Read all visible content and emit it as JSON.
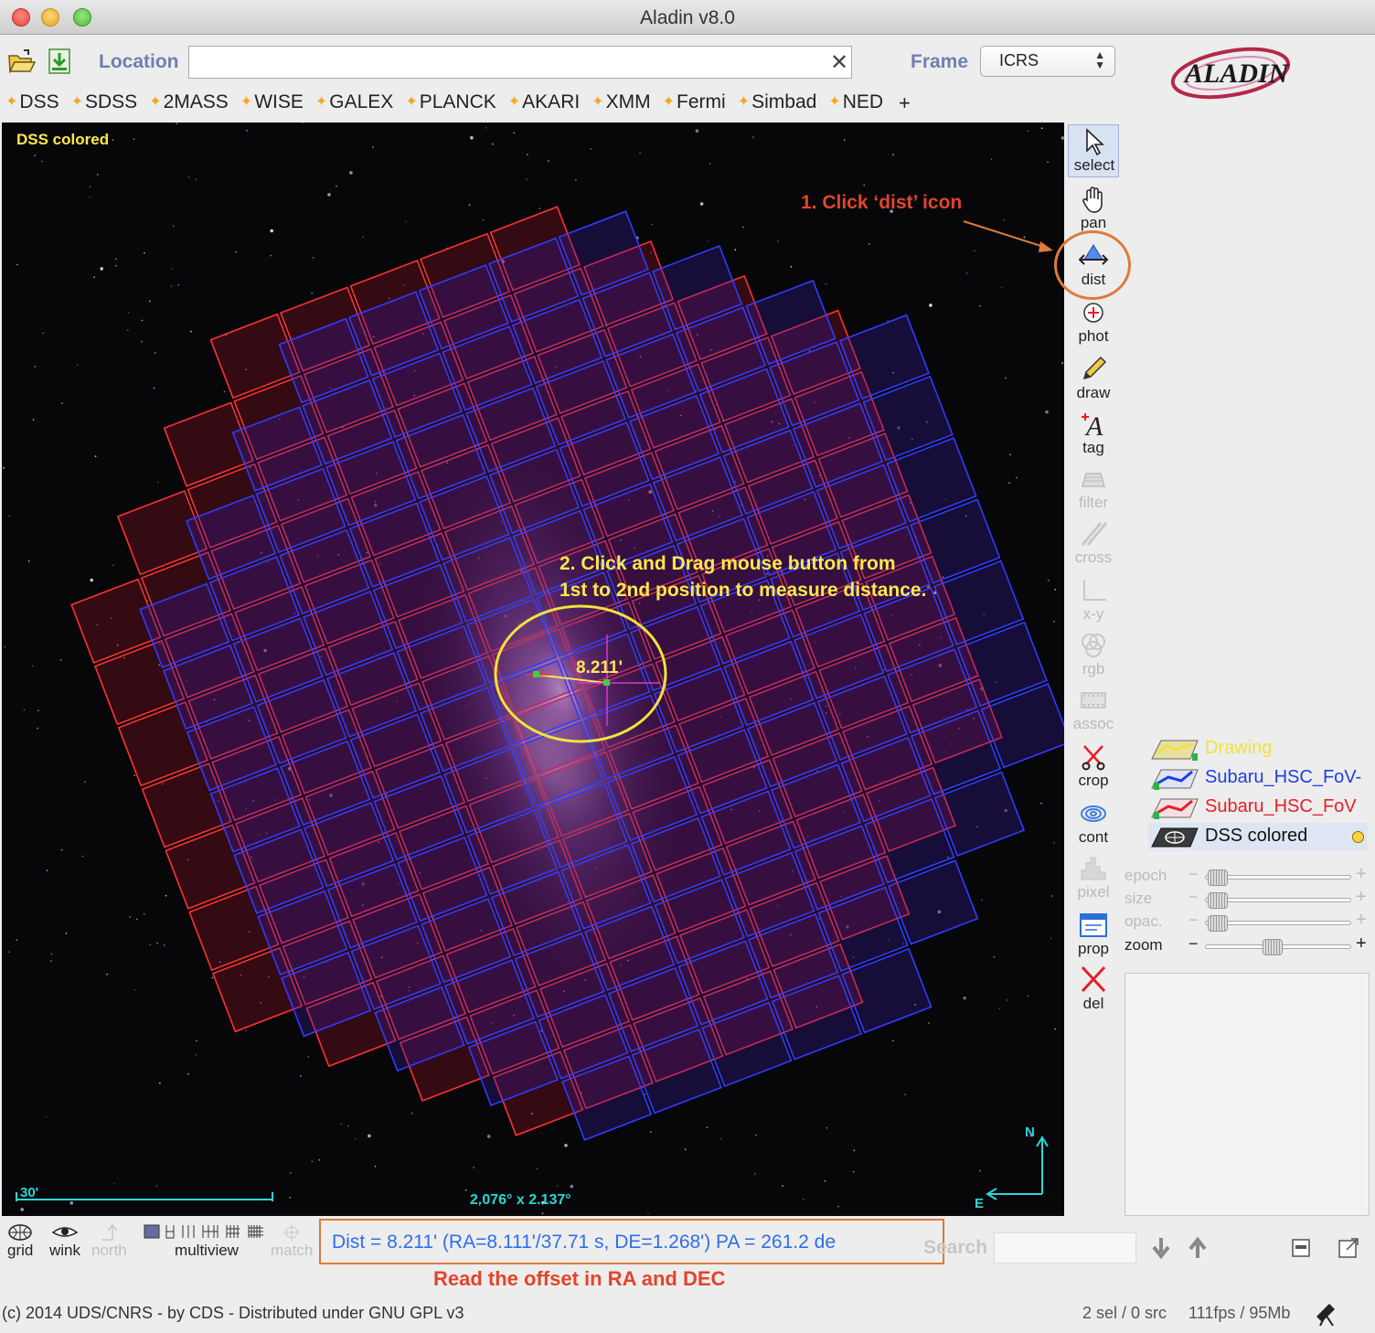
{
  "window": {
    "title": "Aladin v8.0"
  },
  "toolbar": {
    "location_label": "Location",
    "location_value": "",
    "frame_label": "Frame",
    "frame_value": "ICRS"
  },
  "surveys": [
    "DSS",
    "SDSS",
    "2MASS",
    "WISE",
    "GALEX",
    "PLANCK",
    "AKARI",
    "XMM",
    "Fermi",
    "Simbad",
    "NED"
  ],
  "surveys_plus": "+",
  "logo_text": "ALADIN",
  "view": {
    "current_image_label": "DSS colored",
    "scale_label": "30'",
    "fov_label": "2.076° x 2.137°",
    "compass_north": "N",
    "compass_east": "E",
    "distance_value": "8.211'"
  },
  "annotations": {
    "step1": "1. Click ‘dist’ icon",
    "step2_line1": "2. Click and Drag mouse button from",
    "step2_line2": "1st to 2nd position to measure distance.",
    "step3": "Read the offset in RA and DEC"
  },
  "tools": {
    "select": "select",
    "pan": "pan",
    "dist": "dist",
    "phot": "phot",
    "draw": "draw",
    "tag": "tag",
    "filter": "filter",
    "cross": "cross",
    "xy": "x-y",
    "rgb": "rgb",
    "assoc": "assoc",
    "crop": "crop",
    "cont": "cont",
    "pixel": "pixel",
    "prop": "prop",
    "del": "del"
  },
  "layers": [
    {
      "name": "Drawing",
      "color": "#f2e23a"
    },
    {
      "name": "Subaru_HSC_FoV-",
      "color": "#1f3ee0"
    },
    {
      "name": "Subaru_HSC_FoV",
      "color": "#e4202a"
    },
    {
      "name": "DSS colored",
      "color": "#111111"
    }
  ],
  "sliders": {
    "epoch": "epoch",
    "size": "size",
    "opacity": "opac.",
    "zoom": "zoom",
    "zoom_level": 0.45
  },
  "bottom": {
    "grid": "grid",
    "wink": "wink",
    "north": "north",
    "multiview": "multiview",
    "match": "match",
    "status_text": "Dist = 8.211' (RA=8.111'/37.71 s, DE=1.268') PA = 261.2 de",
    "search_label": "Search",
    "copyright": "(c) 2014 UDS/CNRS - by CDS - Distributed under GNU GPL v3",
    "selection_status": "2 sel / 0 src",
    "perf_status": "111fps / 95Mb"
  },
  "colors": {
    "red_fov": "#ff3030",
    "blue_fov": "#2f3cff",
    "annotation_red": "#e2452b",
    "annotation_yellow": "#ffe94a",
    "status_blue": "#2f6ee8"
  }
}
